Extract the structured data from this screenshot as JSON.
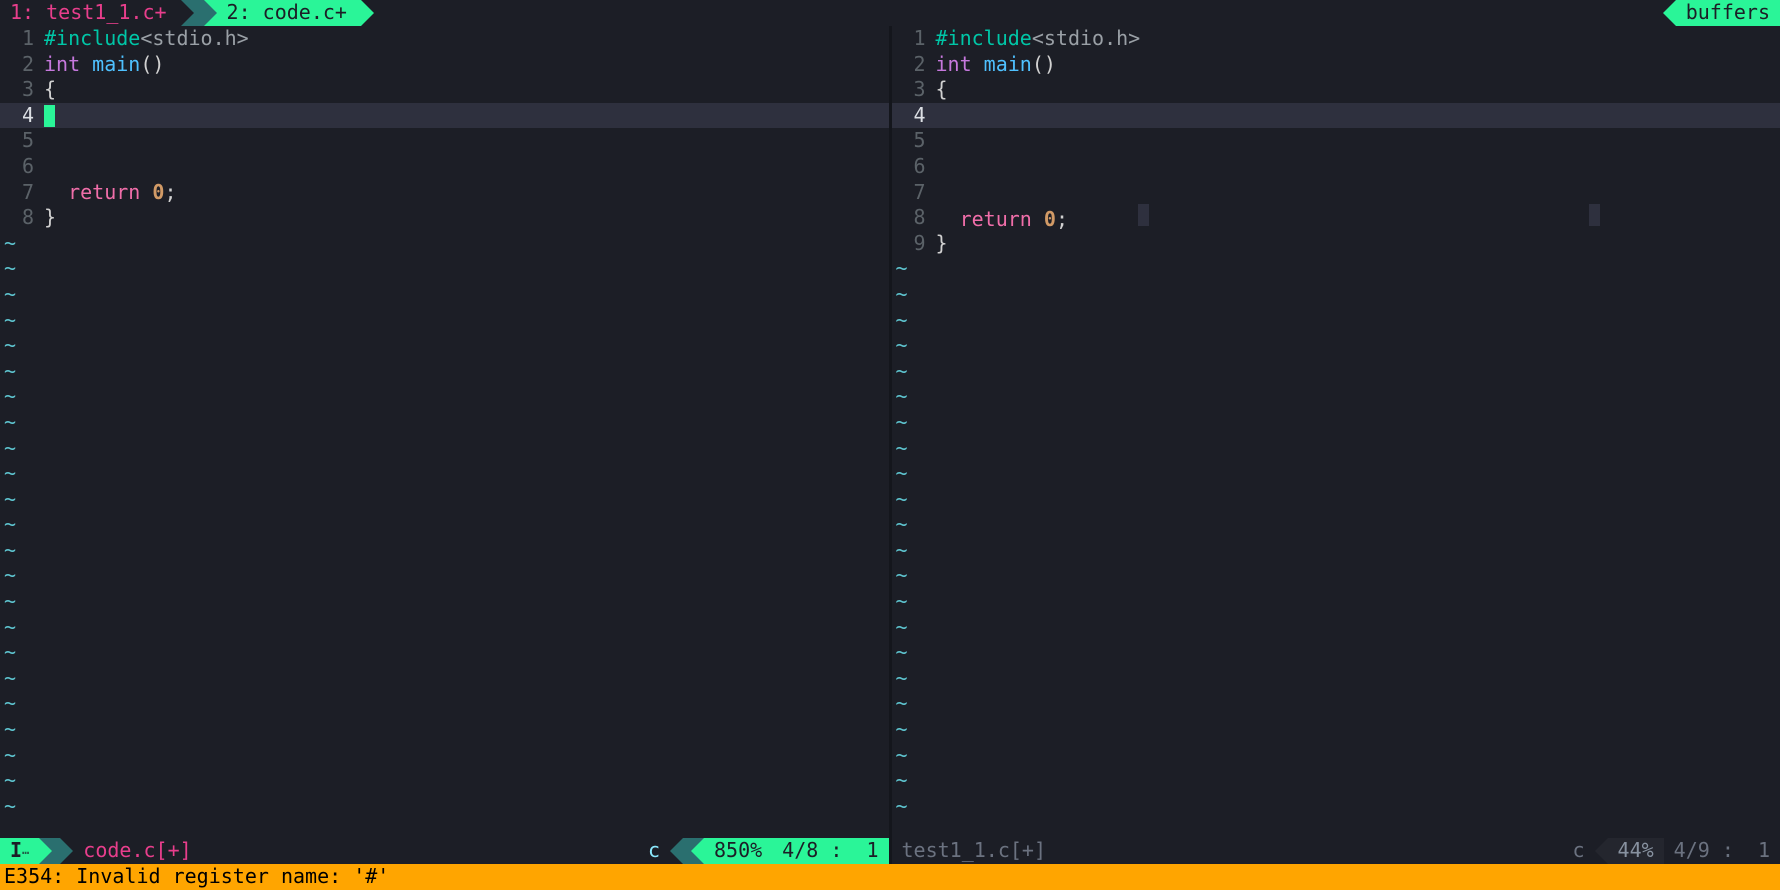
{
  "tabline": {
    "tabs": [
      {
        "label": "1: test1_1.c+",
        "active": false
      },
      {
        "label": "2: code.c+",
        "active": true
      }
    ],
    "buffers_label": "buffers"
  },
  "panes": {
    "left": {
      "current_line": 4,
      "total_lines": 8,
      "lines": [
        {
          "n": 1,
          "tokens": [
            [
              "kw-prep",
              "#include"
            ],
            [
              "str",
              "<stdio.h>"
            ]
          ]
        },
        {
          "n": 2,
          "tokens": [
            [
              "kw-type",
              "int "
            ],
            [
              "fn",
              "main"
            ],
            [
              "punct",
              "()"
            ]
          ]
        },
        {
          "n": 3,
          "tokens": [
            [
              "punct",
              "{"
            ]
          ]
        },
        {
          "n": 4,
          "tokens": []
        },
        {
          "n": 5,
          "tokens": []
        },
        {
          "n": 6,
          "tokens": []
        },
        {
          "n": 7,
          "tokens": [
            [
              "plain",
              "  "
            ],
            [
              "kw-ret",
              "return "
            ],
            [
              "num",
              "0"
            ],
            [
              "punct",
              ";"
            ]
          ]
        },
        {
          "n": 8,
          "tokens": [
            [
              "punct",
              "}"
            ]
          ]
        }
      ]
    },
    "right": {
      "current_line": 4,
      "total_lines": 9,
      "lines": [
        {
          "n": 1,
          "tokens": [
            [
              "kw-prep",
              "#include"
            ],
            [
              "str",
              "<stdio.h>"
            ]
          ]
        },
        {
          "n": 2,
          "tokens": [
            [
              "kw-type",
              "int "
            ],
            [
              "fn",
              "main"
            ],
            [
              "punct",
              "()"
            ]
          ]
        },
        {
          "n": 3,
          "tokens": [
            [
              "punct",
              "{"
            ]
          ]
        },
        {
          "n": 4,
          "tokens": []
        },
        {
          "n": 5,
          "tokens": []
        },
        {
          "n": 6,
          "tokens": []
        },
        {
          "n": 7,
          "tokens": []
        },
        {
          "n": 8,
          "tokens": [
            [
              "plain",
              "  "
            ],
            [
              "kw-ret",
              "return "
            ],
            [
              "num",
              "0"
            ],
            [
              "punct",
              ";"
            ]
          ],
          "trail_ws": true
        },
        {
          "n": 9,
          "tokens": [
            [
              "punct",
              "}"
            ]
          ]
        }
      ]
    }
  },
  "statusline": {
    "left": {
      "mode": "I",
      "file": "code.c[+]",
      "filetype": "c",
      "percent": "850%",
      "pos": "4/8 :  1"
    },
    "right": {
      "file": "test1_1.c[+]",
      "filetype": "c",
      "percent": "44%",
      "pos": "4/9 :  1"
    }
  },
  "cmdline": {
    "text": "E354: Invalid register name: '#'"
  },
  "colors": {
    "bg": "#1c1e26",
    "accent": "#2af598",
    "magenta": "#e83e8c",
    "error_bg": "#ffa500"
  }
}
